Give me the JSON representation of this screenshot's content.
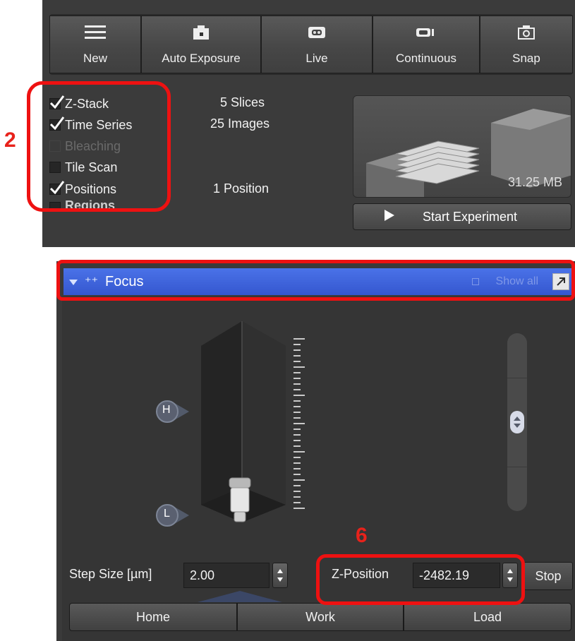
{
  "toolbar": {
    "buttons": [
      {
        "label": "New",
        "icon": "menu-lines-icon"
      },
      {
        "label": "Auto Exposure",
        "icon": "camera-icon"
      },
      {
        "label": "Live",
        "icon": "video-camera-icon"
      },
      {
        "label": "Continuous",
        "icon": "continuous-camera-icon"
      },
      {
        "label": "Snap",
        "icon": "snapshot-camera-icon"
      }
    ]
  },
  "experiment": {
    "options": [
      {
        "label": "Z-Stack",
        "checked": true,
        "enabled": true
      },
      {
        "label": "Time Series",
        "checked": true,
        "enabled": true
      },
      {
        "label": "Bleaching",
        "checked": false,
        "enabled": false
      },
      {
        "label": "Tile Scan",
        "checked": false,
        "enabled": true
      },
      {
        "label": "Positions",
        "checked": true,
        "enabled": true
      },
      {
        "label": "Regions",
        "checked": false,
        "enabled": false
      }
    ],
    "info": {
      "slices": "5 Slices",
      "images": "25 Images",
      "positions": "1 Position"
    },
    "data_size": "31.25 MB",
    "start_label": "Start Experiment"
  },
  "annotations": {
    "label_2": "2",
    "label_6": "6",
    "color": "#ee1111"
  },
  "focus": {
    "title": "Focus",
    "show_all": "Show all",
    "marker_high": "H",
    "marker_low": "L",
    "step_size_label": "Step Size [µm]",
    "step_size_value": "2.00",
    "z_position_label": "Z-Position",
    "z_position_value": "-2482.19",
    "stop_label": "Stop",
    "buttons": {
      "home": "Home",
      "work": "Work",
      "load": "Load"
    },
    "header_color": "#3d62dc"
  }
}
